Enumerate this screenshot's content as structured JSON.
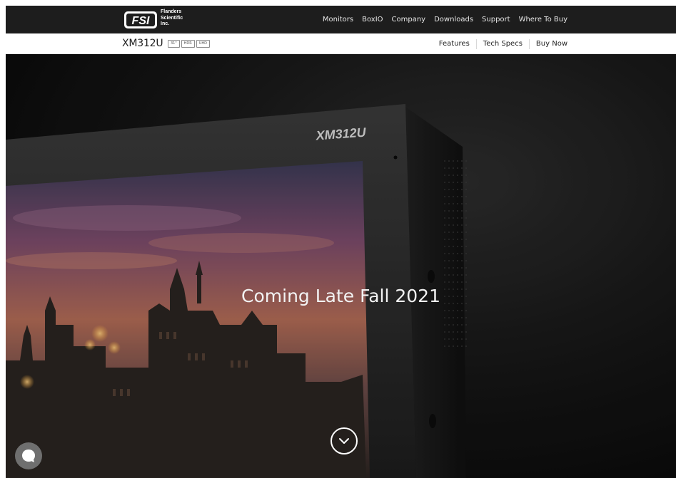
{
  "brand": {
    "logo_mark": "FSI",
    "name_lines": [
      "Flanders",
      "Scientific",
      "Inc."
    ]
  },
  "nav": {
    "items": [
      "Monitors",
      "BoxIO",
      "Company",
      "Downloads",
      "Support",
      "Where To Buy"
    ]
  },
  "product": {
    "model": "XM312U",
    "badges": [
      "31\"",
      "HDR",
      "UHD"
    ],
    "links": [
      "Features",
      "Tech Specs",
      "Buy Now"
    ]
  },
  "hero": {
    "title": "Coming Late Fall 2021",
    "bezel_model": "XM312U",
    "scroll_icon": "chevron-down-circle-icon",
    "chat_icon": "chat-bubble-icon"
  },
  "colors": {
    "nav_bg": "#1d1d1d",
    "hero_bg": "#141414",
    "text_light": "#f2f2f2"
  }
}
